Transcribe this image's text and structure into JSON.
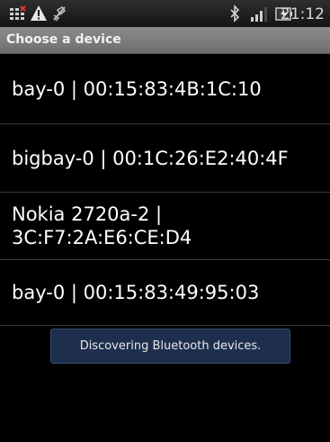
{
  "status_bar": {
    "time": "21:12",
    "icons": [
      "menu-grid-icon",
      "warning-icon",
      "usb-debug-icon",
      "bluetooth-icon",
      "signal-icon",
      "battery-charging-icon"
    ]
  },
  "title_bar": {
    "title": "Choose a device"
  },
  "devices": [
    {
      "label": "bay-0 | 00:15:83:4B:1C:10"
    },
    {
      "label": "bigbay-0 | 00:1C:26:E2:40:4F"
    },
    {
      "label": "Nokia 2720a-2 | 3C:F7:2A:E6:CE:D4"
    },
    {
      "label": "bay-0 | 00:15:83:49:95:03"
    }
  ],
  "toast": {
    "message": "Discovering Bluetooth devices."
  },
  "colors": {
    "background": "#000000",
    "title_bar": "#7d7d7d",
    "toast_background": "#1e2f4e"
  }
}
